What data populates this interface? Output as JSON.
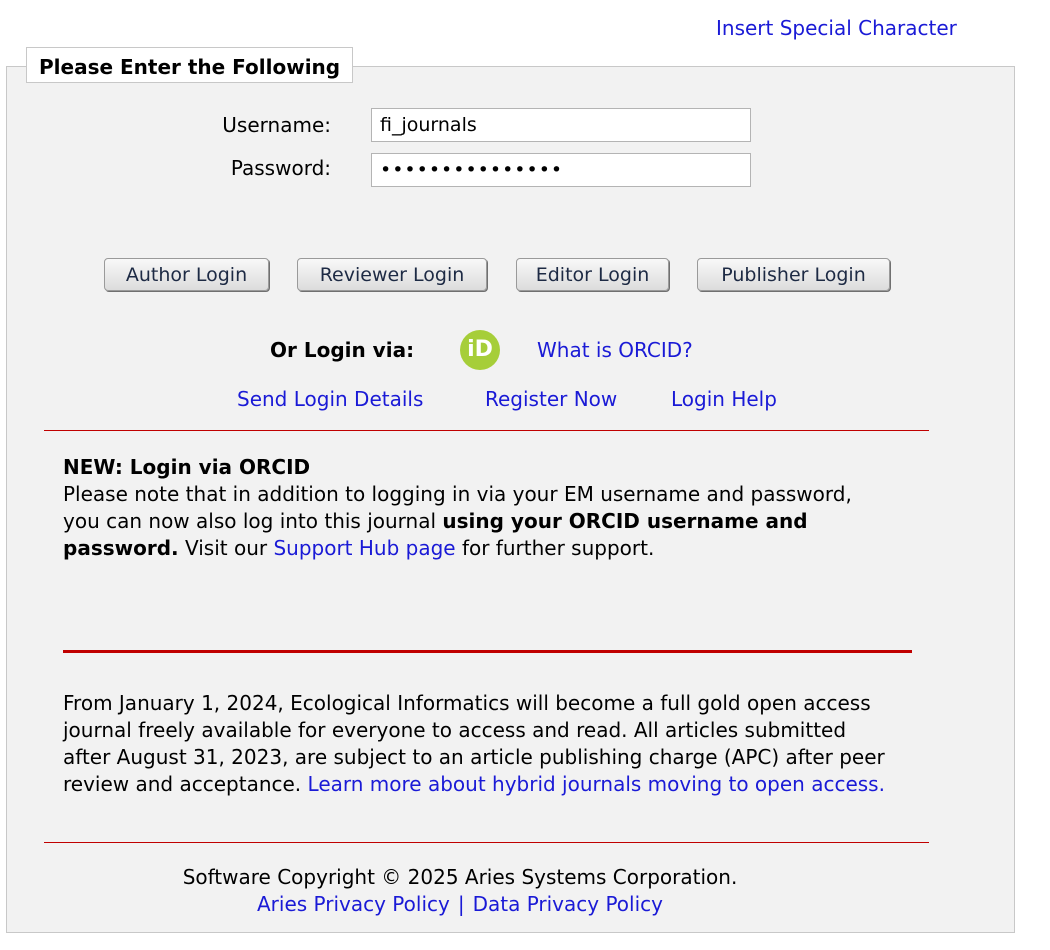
{
  "header": {
    "special_char_link": "Insert Special Character"
  },
  "form": {
    "legend": "Please Enter the Following",
    "username_label": "Username:",
    "username_value": "fi_journals",
    "password_label": "Password:",
    "password_value": "•••••••••••••••"
  },
  "buttons": {
    "author": "Author Login",
    "reviewer": "Reviewer Login",
    "editor": "Editor Login",
    "publisher": "Publisher Login"
  },
  "orcid": {
    "label": "Or Login via:",
    "icon_text": "iD",
    "what_is": "What is ORCID?"
  },
  "links": {
    "send_login": "Send Login Details",
    "register": "Register Now",
    "help": "Login Help"
  },
  "notice_orcid": {
    "title": "NEW: Login via ORCID",
    "text_1": "Please note that in addition to logging in via your EM username and password, you can now also log into this journal ",
    "bold": "using your ORCID username and password.",
    "text_2": " Visit our ",
    "link": "Support Hub page",
    "text_3": " for further support."
  },
  "notice_oa": {
    "text": "From January 1, 2024, Ecological Informatics will become a full gold open access journal freely available for everyone to access and read. All articles submitted after August 31, 2023, are subject to an article publishing charge (APC) after peer review and acceptance. ",
    "link": "Learn more about hybrid journals moving to open access."
  },
  "footer": {
    "copyright": "Software Copyright © 2025 Aries Systems Corporation.",
    "aries_privacy": "Aries Privacy Policy",
    "separator": "|",
    "data_privacy": "Data Privacy Policy"
  },
  "colors": {
    "link": "#1a1ad6",
    "rule": "#c00000",
    "panel_bg": "#f2f2f2",
    "orcid_green": "#a6ce39"
  }
}
